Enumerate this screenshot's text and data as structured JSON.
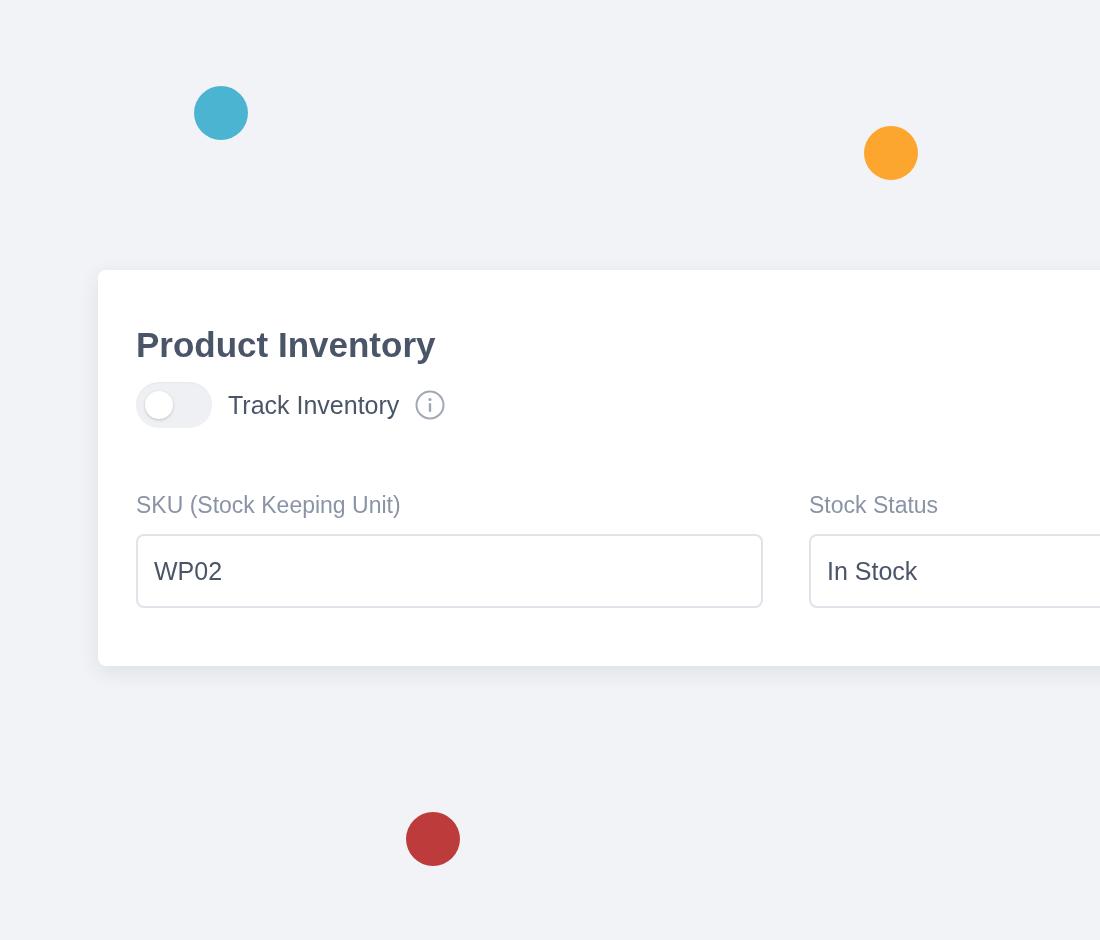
{
  "decorations": [
    {
      "color": "#4bb5d1"
    },
    {
      "color": "#fca52f"
    },
    {
      "color": "#bd3b3b"
    }
  ],
  "card": {
    "title": "Product Inventory",
    "toggle": {
      "label": "Track Inventory",
      "on": false
    },
    "fields": [
      {
        "label": "SKU (Stock Keeping Unit)",
        "value": "WP02"
      },
      {
        "label": "Stock Status",
        "value": "In Stock"
      }
    ]
  }
}
